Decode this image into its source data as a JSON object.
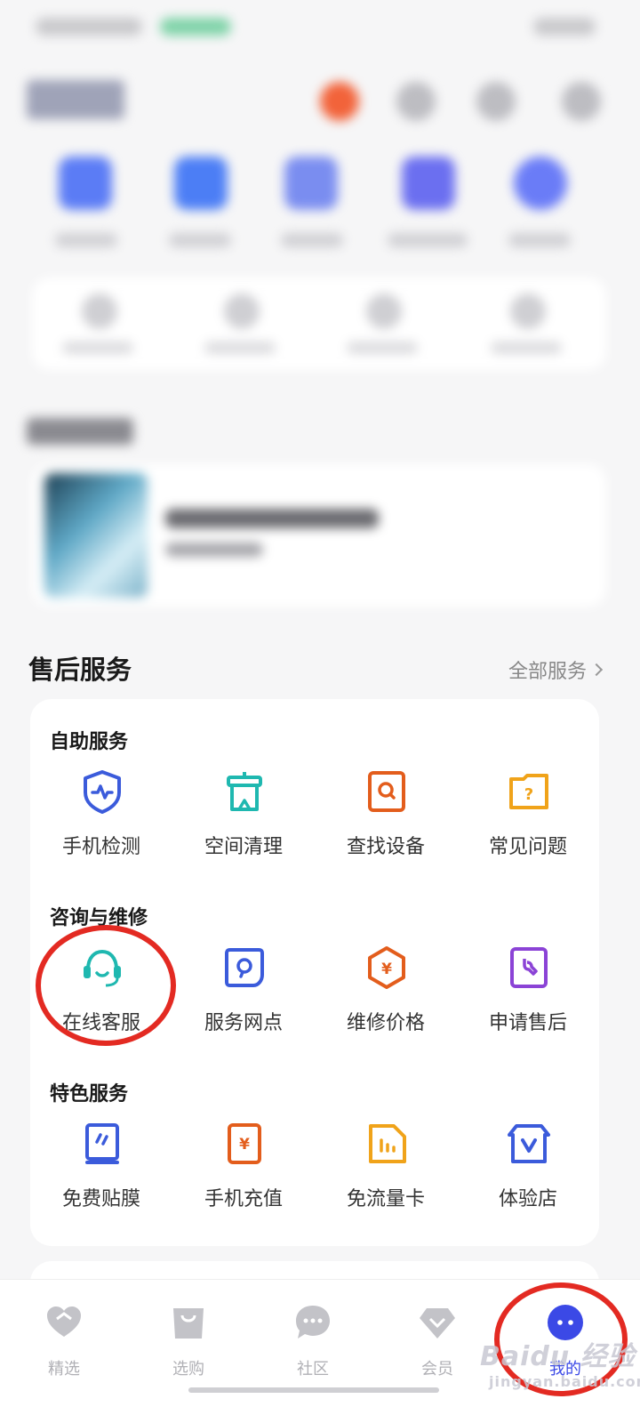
{
  "section": {
    "title": "售后服务",
    "more_label": "全部服务"
  },
  "groups": [
    {
      "title": "自助服务",
      "items": [
        {
          "label": "手机检测",
          "icon": "shield-pulse-icon",
          "color": "#3b5bdb"
        },
        {
          "label": "空间清理",
          "icon": "trash-can-icon",
          "color": "#1fb8b0"
        },
        {
          "label": "查找设备",
          "icon": "search-box-icon",
          "color": "#e35d1c"
        },
        {
          "label": "常见问题",
          "icon": "question-folder-icon",
          "color": "#f0a31a"
        }
      ]
    },
    {
      "title": "咨询与维修",
      "items": [
        {
          "label": "在线客服",
          "icon": "headset-icon",
          "color": "#1fb8b0"
        },
        {
          "label": "服务网点",
          "icon": "location-pin-icon",
          "color": "#3b5bdb"
        },
        {
          "label": "维修价格",
          "icon": "yen-hexagon-icon",
          "color": "#e35d1c"
        },
        {
          "label": "申请售后",
          "icon": "wrench-box-icon",
          "color": "#8b43d6"
        }
      ]
    },
    {
      "title": "特色服务",
      "items": [
        {
          "label": "免费贴膜",
          "icon": "screen-film-icon",
          "color": "#3b5bdb"
        },
        {
          "label": "手机充值",
          "icon": "yen-phone-icon",
          "color": "#e35d1c"
        },
        {
          "label": "免流量卡",
          "icon": "sim-card-icon",
          "color": "#f0a31a"
        },
        {
          "label": "体验店",
          "icon": "store-icon",
          "color": "#3b5bdb"
        }
      ]
    }
  ],
  "nav": [
    {
      "label": "精选",
      "icon": "heart-icon",
      "active": false
    },
    {
      "label": "选购",
      "icon": "shopping-bag-icon",
      "active": false
    },
    {
      "label": "社区",
      "icon": "chat-bubble-icon",
      "active": false
    },
    {
      "label": "会员",
      "icon": "diamond-icon",
      "active": false
    },
    {
      "label": "我的",
      "icon": "profile-dots-icon",
      "active": true
    }
  ],
  "watermark": {
    "text": "Baidu 经验",
    "sub": "jingyan.baidu.com"
  },
  "colors": {
    "accent": "#3b49e6",
    "annotation": "#e32a22"
  }
}
